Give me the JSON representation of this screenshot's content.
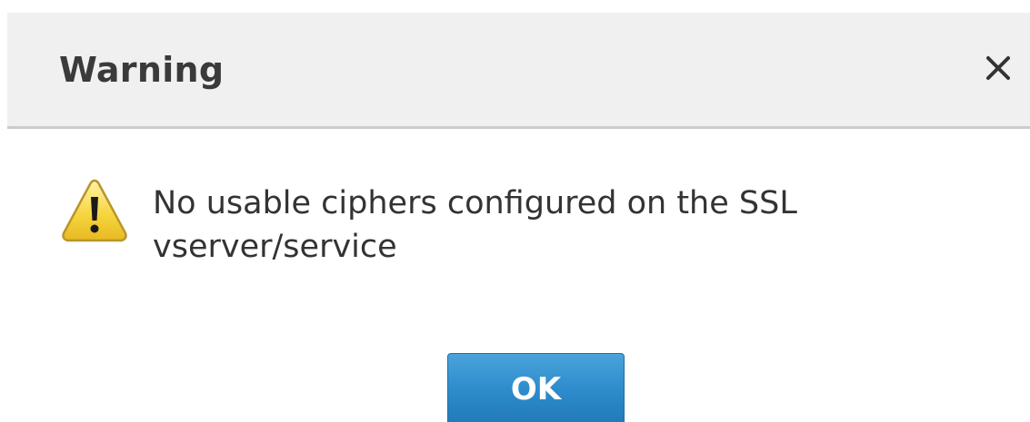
{
  "dialog": {
    "title": "Warning",
    "close_icon": "close-icon",
    "warning_icon": "warning-triangle-icon",
    "message_line1": "No usable ciphers configured on the SSL",
    "message_line2": "vserver/service",
    "ok_label": "OK"
  },
  "colors": {
    "header_bg": "#f0f0f0",
    "header_border": "#cccccc",
    "title_text": "#3a3a3a",
    "message_text": "#333333",
    "warning_fill": "#f5d33a",
    "button_bg": "#2f8ccc",
    "button_text": "#ffffff"
  }
}
